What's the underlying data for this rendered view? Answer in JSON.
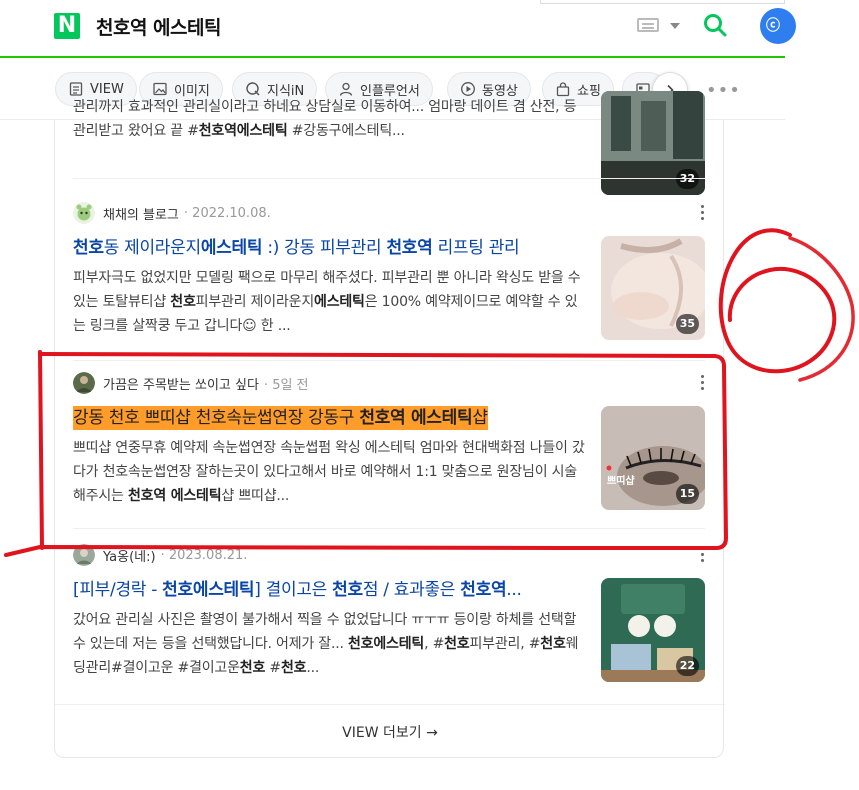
{
  "header": {
    "logo": "N",
    "query": "천호역 에스테틱"
  },
  "tabs": [
    {
      "label": "VIEW",
      "icon": "view-icon"
    },
    {
      "label": "이미지",
      "icon": "image-icon"
    },
    {
      "label": "지식iN",
      "icon": "kin-icon"
    },
    {
      "label": "인플루언서",
      "icon": "person-icon"
    },
    {
      "label": "동영상",
      "icon": "play-icon"
    },
    {
      "label": "쇼핑",
      "icon": "bag-icon"
    }
  ],
  "results": [
    {
      "title_parts": [],
      "desc": "관리까지 효과적인 관리실이라고 하네요 상담실로 이동하여... 엄마랑 데이트 겸 산전, 등관리받고 왔어요 끝 #천호역에스테틱 #강동구에스테틱...",
      "thumb_count": "32"
    },
    {
      "author": "채채의 블로그",
      "date": "2022.10.08.",
      "title": "천호동 제이라운지에스테틱 :) 강동 피부관리 천호역 리프팅 관리",
      "desc": "피부자극도 없었지만 모델링 팩으로 마무리 해주셨다. 피부관리 뿐 아니라 왁싱도 받을 수 있는 토탈뷰티샵 천호피부관리 제이라운지에스테틱은 100% 예약제이므로 예약할 수 있는 링크를 살짝쿵 두고 갑니다☺ 한 ...",
      "thumb_count": "35"
    },
    {
      "author": "가끔은 주목받는 쏘이고 싶다",
      "date": "5일 전",
      "title": "강동 천호 쁘띠샵 천호속눈썹연장 강동구 천호역 에스테틱샵",
      "desc": "쁘띠샵 연중무휴 예약제 속눈썹연장 속눈썹펌 왁싱 에스테틱 엄마와 현대백화점 나들이 갔다가 천호속눈썹연장 잘하는곳이 있다고해서 바로 예약해서 1:1 맞춤으로 원장님이 시술해주시는 천호역 에스테틱샵 쁘띠샵...",
      "thumb_label": "쁘띠샵",
      "thumb_count": "15"
    },
    {
      "author": "Ya옹(네:)",
      "date": "2023.08.21.",
      "title": "[피부/경락 - 천호에스테틱] 결이고은 천호점 / 효과좋은 천호역...",
      "desc": "갔어요 관리실 사진은 촬영이 불가해서 찍을 수 없었답니다 ㅠㅜㅠ 등이랑 하체를 선택할 수 있는데 저는 등을 선택했답니다. 어제가 잘... 천호에스테틱, #천호피부관리, #천호웨딩관리#결이고운 #결이고운천호 #천호...",
      "thumb_count": "22"
    }
  ],
  "view_more": "VIEW 더보기 →",
  "annotation": {
    "number": "6",
    "color": "#e0141e"
  }
}
